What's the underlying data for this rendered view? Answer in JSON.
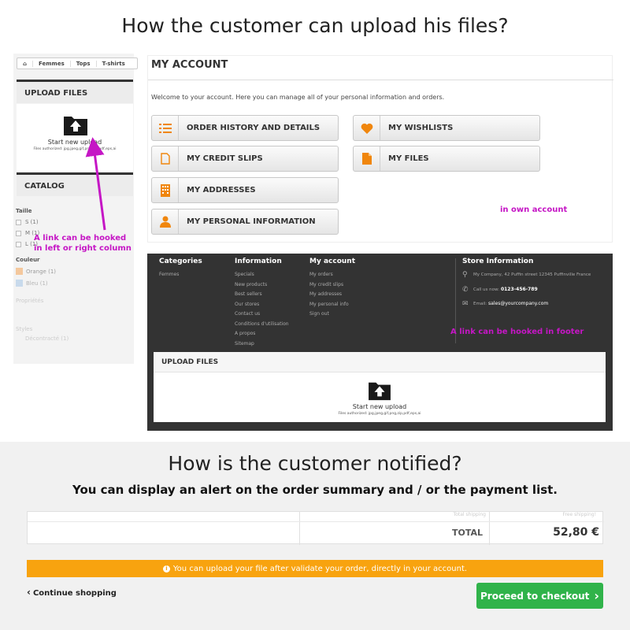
{
  "headings": {
    "upload_question": "How the customer can upload his files?",
    "notify_question": "How is the customer notified?",
    "notify_sub": "You can display an alert on the order summary and / or the payment list."
  },
  "breadcrumb": [
    "Femmes",
    "Tops",
    "T-shirts"
  ],
  "left_column": {
    "upload_title": "UPLOAD FILES",
    "start_upload": "Start new upload",
    "files_authorized": "Files authorized: jpg,jpeg,gif,png,zip,pdf,eps,ai",
    "catalog_title": "CATALOG",
    "filter_size_label": "Taille",
    "sizes": [
      "S (1)",
      "M (1)",
      "L (1)"
    ],
    "filter_color_label": "Couleur",
    "colors": [
      "Orange (1)",
      "Bleu (1)"
    ],
    "filter_extra_label": "Propriétés",
    "filter_style_label": "Styles",
    "style_value": "Décontracté (1)"
  },
  "annotations": {
    "left": "A link can be hooked\nin left or right column",
    "account": "in own account",
    "footer": "A link can be hooked in footer"
  },
  "account": {
    "title": "MY ACCOUNT",
    "welcome": "Welcome to your account. Here you can manage all of your personal information and orders.",
    "buttons": [
      {
        "label": "ORDER HISTORY AND DETAILS",
        "icon": "list-icon"
      },
      {
        "label": "MY CREDIT SLIPS",
        "icon": "document-outline-icon"
      },
      {
        "label": "MY ADDRESSES",
        "icon": "building-icon"
      },
      {
        "label": "MY PERSONAL INFORMATION",
        "icon": "user-icon"
      },
      {
        "label": "MY WISHLISTS",
        "icon": "heart-icon"
      },
      {
        "label": "MY FILES",
        "icon": "file-icon"
      }
    ]
  },
  "footer": {
    "categories_title": "Categories",
    "categories": [
      "Femmes"
    ],
    "information_title": "Information",
    "information": [
      "Specials",
      "New products",
      "Best sellers",
      "Our stores",
      "Contact us",
      "Conditions d'utilisation",
      "A propos",
      "Sitemap"
    ],
    "account_title": "My account",
    "account_links": [
      "My orders",
      "My credit slips",
      "My addresses",
      "My personal info",
      "Sign out"
    ],
    "store_title": "Store Information",
    "store_address": "My Company, 42 Puffin street 12345 Puffinville France",
    "store_phone_prefix": "Call us now:",
    "store_phone": "0123-456-789",
    "store_email_prefix": "Email:",
    "store_email": "sales@yourcompany.com",
    "upload_title": "UPLOAD FILES",
    "start_upload": "Start new upload",
    "files_authorized": "Files authorized: jpg,jpeg,gif,png,zip,pdf,eps,ai"
  },
  "cart": {
    "total_shipping_label": "Total shipping",
    "total_shipping_value": "Free shipping!",
    "total_label": "TOTAL",
    "total_value": "52,80 €",
    "alert": "You can upload your file after validate your order, directly in your account.",
    "continue": "Continue shopping",
    "checkout": "Proceed to checkout"
  },
  "colors": {
    "accent": "#f0860d",
    "annotation": "#c516c5",
    "alert": "#f8a30f",
    "checkout": "#30b34a"
  }
}
